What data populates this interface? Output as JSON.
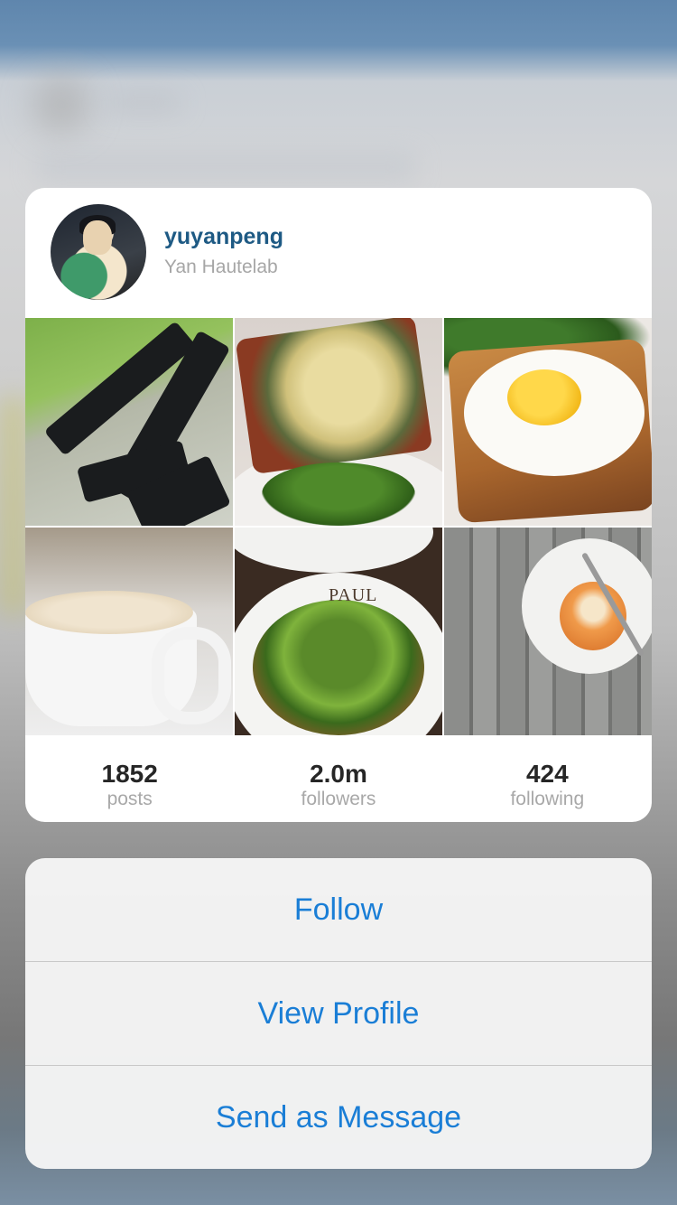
{
  "profile": {
    "username": "yuyanpeng",
    "full_name": "Yan Hautelab",
    "avatar_icon": "profile-photo"
  },
  "grid": {
    "photos": [
      {
        "subject": "rifles on grass"
      },
      {
        "subject": "pizza with salad"
      },
      {
        "subject": "fried egg toast"
      },
      {
        "subject": "cappuccino cup"
      },
      {
        "subject": "salad plate",
        "plate_text": "PAUL"
      },
      {
        "subject": "pastry on plate"
      }
    ]
  },
  "stats": {
    "posts": {
      "value": "1852",
      "label": "posts"
    },
    "followers": {
      "value": "2.0m",
      "label": "followers"
    },
    "following": {
      "value": "424",
      "label": "following"
    }
  },
  "actions": {
    "follow": "Follow",
    "view_profile": "View Profile",
    "send_message": "Send as Message"
  },
  "colors": {
    "accent": "#1a7ed6",
    "username": "#1e5a84",
    "muted": "#a8a8a8"
  }
}
